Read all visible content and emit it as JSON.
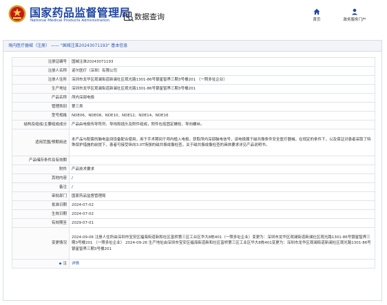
{
  "header": {
    "brand_cn": "国家药品监督管理局",
    "brand_en": "National Medical Products Administration",
    "data_query_label": "数据查询",
    "nav_home": "首页",
    "nav_portal": "政务服务门户"
  },
  "panel": {
    "title": "境内医疗器械（注册） —— \"国械注准20243071193\" 基本信息"
  },
  "rows": [
    {
      "label": "注册证编号",
      "value": "国械注准20243071193",
      "h": 13
    },
    {
      "label": "注册人名称",
      "value": "诺尔医疗（深圳）有限公司",
      "h": 13
    },
    {
      "label": "注册人住所",
      "value": "深圳市龙华区观澜街道新澜社区观光路1301-86号银星智界三期3号楼201 （一照多址企业）",
      "h": 13
    },
    {
      "label": "生产地址",
      "value": "深圳市龙华区观澜街道新澜社区观光路1301-86号银星智界三期3号楼201",
      "h": 13
    },
    {
      "label": "产品名称",
      "value": "颅内深部电极",
      "h": 13
    },
    {
      "label": "管理类别",
      "value": "第三类",
      "h": 13
    },
    {
      "label": "型号规格",
      "value": "NDE06、NDE08、NDE10、NDE12、NDE14、NDE16",
      "h": 13
    },
    {
      "label": "结构及组成/主要组成成分",
      "value": "产品由电极传导阵列、导线和插头及附件组成，附件包括固定螺栓、导向螺丝。",
      "h": 13
    },
    {
      "label": "适用范围/预期用途",
      "value": "本产品与配套的脑电监测设备配合使用，用于手术期间于颅内植入电极，获取颅内深部脑电信号，该电极属于磁共振条件安全医疗器械，在规定的条件下，以及保证对患者采取了特殊保护措施的前提下，患者可接受纵向3.0T场强的磁共振成像检查，关于磁共振成像检查的具体要求详见产品说明书。",
      "h": 39
    },
    {
      "label": "产品储存条件及有效期",
      "value": "",
      "h": 13
    },
    {
      "label": "附件",
      "value": "产品技术要求",
      "h": 13
    },
    {
      "label": "其他内容",
      "value": "/",
      "h": 13
    },
    {
      "label": "备注",
      "value": "/",
      "h": 13
    },
    {
      "label": "审批部门",
      "value": "国家药品监督管理局",
      "h": 13
    },
    {
      "label": "批准日期",
      "value": "2024-07-02",
      "h": 13
    },
    {
      "label": "生效日期",
      "value": "2024-07-02",
      "h": 13
    },
    {
      "label": "有效期至",
      "value": "2029-07-01",
      "h": 13
    },
    {
      "label": "变更情况",
      "value": "2024-09-06 注册人住所由深圳市宝安区福海街道新和社区富桥第三区工业区华大8栋401（一照多址企业）变更为：深圳市龙华区观澜街道新澜社区观光路1301-86号银星智界三期3号楼201 （一照多址企业） 2024-09-26 生产地址由深圳市宝安区福海街道新和社区富桥第三区工业区华大8栋401变更为：深圳市龙华区观澜街道新澜社区观光路1301-86号银星智界三期3号楼201",
      "h": 46
    },
    {
      "label": "注",
      "value": "详情",
      "h": 13,
      "is_link": true
    }
  ],
  "colors": {
    "brand_blue": "#1f47a8",
    "link_blue": "#2b57b8",
    "emblem_gold": "#d4a020",
    "emblem_red": "#c8161d"
  }
}
